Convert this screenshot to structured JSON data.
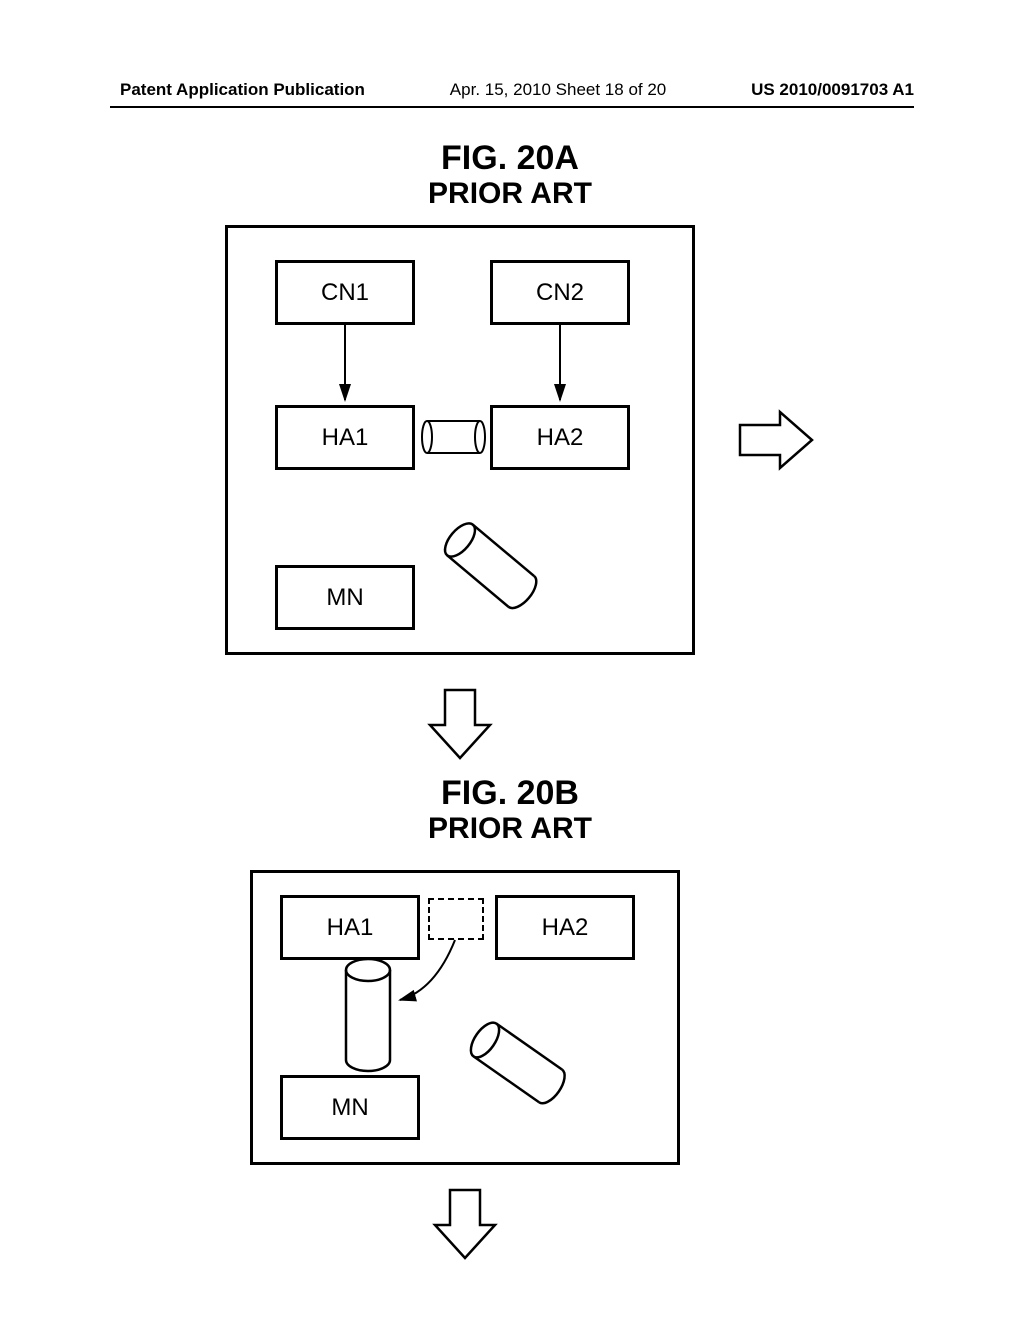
{
  "header": {
    "left": "Patent Application Publication",
    "center": "Apr. 15, 2010  Sheet 18 of 20",
    "right": "US 2010/0091703 A1"
  },
  "figA": {
    "num": "FIG. 20A",
    "prior": "PRIOR ART",
    "cn1": "CN1",
    "cn2": "CN2",
    "ha1": "HA1",
    "ha2": "HA2",
    "mn": "MN"
  },
  "figB": {
    "num": "FIG. 20B",
    "prior": "PRIOR ART",
    "ha1": "HA1",
    "ha2": "HA2",
    "mn": "MN"
  }
}
